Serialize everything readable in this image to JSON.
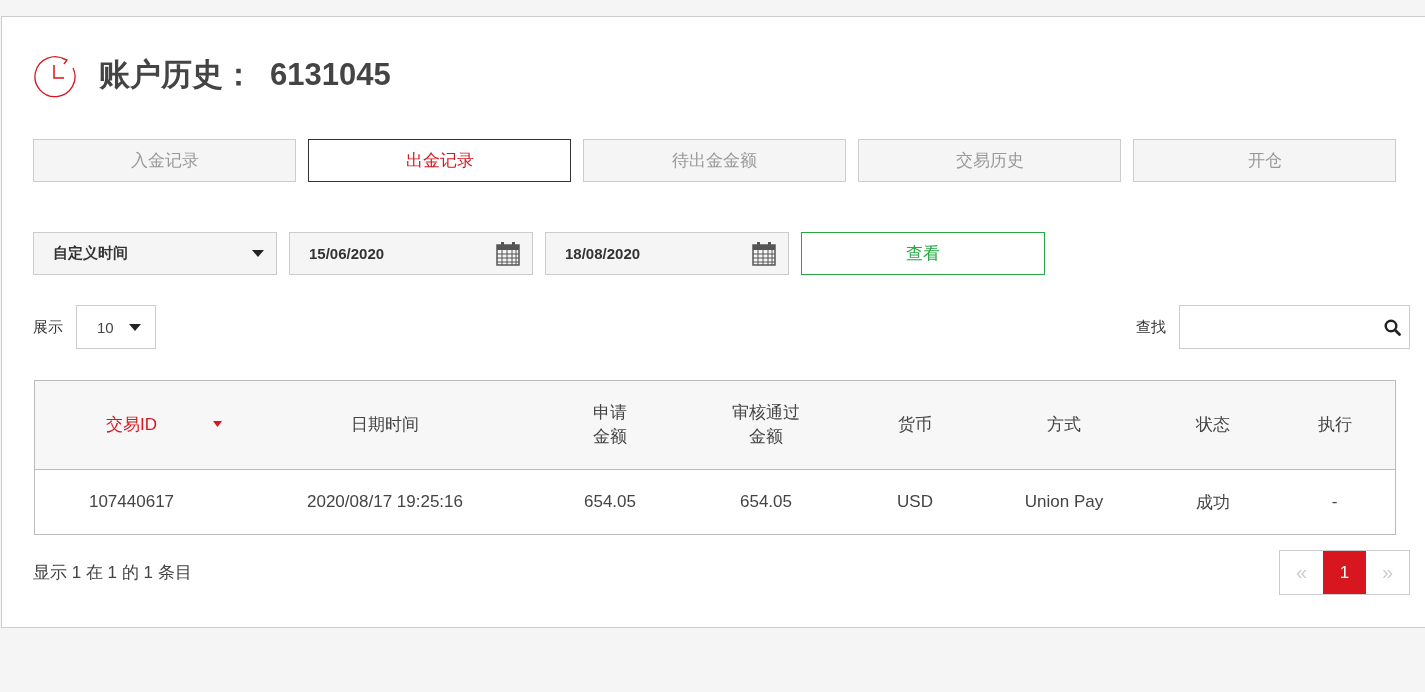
{
  "header": {
    "title": "账户历史：",
    "account": "6131045"
  },
  "tabs": [
    {
      "label": "入金记录",
      "selected": false
    },
    {
      "label": "出金记录",
      "selected": true
    },
    {
      "label": "待出金金额",
      "selected": false
    },
    {
      "label": "交易历史",
      "selected": false
    },
    {
      "label": "开仓",
      "selected": false
    }
  ],
  "filters": {
    "period": "自定义时间",
    "start_date": "15/06/2020",
    "end_date": "18/08/2020",
    "view_button": "查看"
  },
  "page_size": {
    "label": "展示",
    "value": "10"
  },
  "search": {
    "label": "查找"
  },
  "table": {
    "columns": [
      {
        "label": "交易ID",
        "sorted": true
      },
      {
        "label": "日期时间",
        "sorted": false
      },
      {
        "label": "申请金额",
        "sorted": false
      },
      {
        "label": "审核通过金额",
        "sorted": false
      },
      {
        "label": "货币",
        "sorted": false
      },
      {
        "label": "方式",
        "sorted": false
      },
      {
        "label": "状态",
        "sorted": false
      },
      {
        "label": "执行",
        "sorted": false
      }
    ],
    "rows": [
      [
        "107440617",
        "2020/08/17 19:25:16",
        "654.05",
        "654.05",
        "USD",
        "Union Pay",
        "成功",
        "-"
      ]
    ]
  },
  "summary": "显示 1 在 1 的 1 条目",
  "pagination": [
    {
      "label": "«",
      "kind": "prev",
      "selected": false,
      "disabled": true
    },
    {
      "label": "1",
      "kind": "page",
      "selected": true,
      "disabled": false
    },
    {
      "label": "»",
      "kind": "next",
      "selected": false,
      "disabled": true
    }
  ]
}
